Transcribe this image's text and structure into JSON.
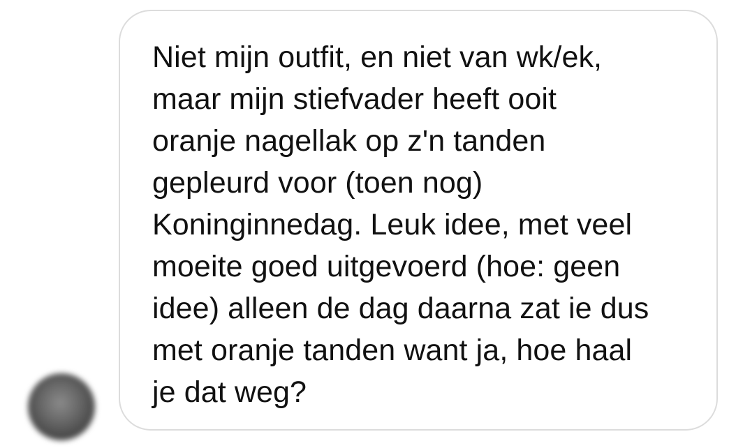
{
  "conversation": {
    "sender": {
      "avatar_icon": "blurred-profile-photo"
    },
    "message": {
      "text": "Niet mijn outfit, en niet van wk/ek,\nmaar mijn stiefvader heeft ooit\noranje nagellak op z'n tanden\ngepleurd voor (toen nog)\nKoninginnedag. Leuk idee, met veel\nmoeite goed uitgevoerd (hoe: geen\nidee) alleen de dag daarna zat ie dus\nmet oranje tanden want ja, hoe haal\nje dat weg?"
    }
  },
  "colors": {
    "bubble_border": "#dcdcdc",
    "bubble_background": "#ffffff",
    "text": "#111111",
    "page_background": "#ffffff"
  }
}
